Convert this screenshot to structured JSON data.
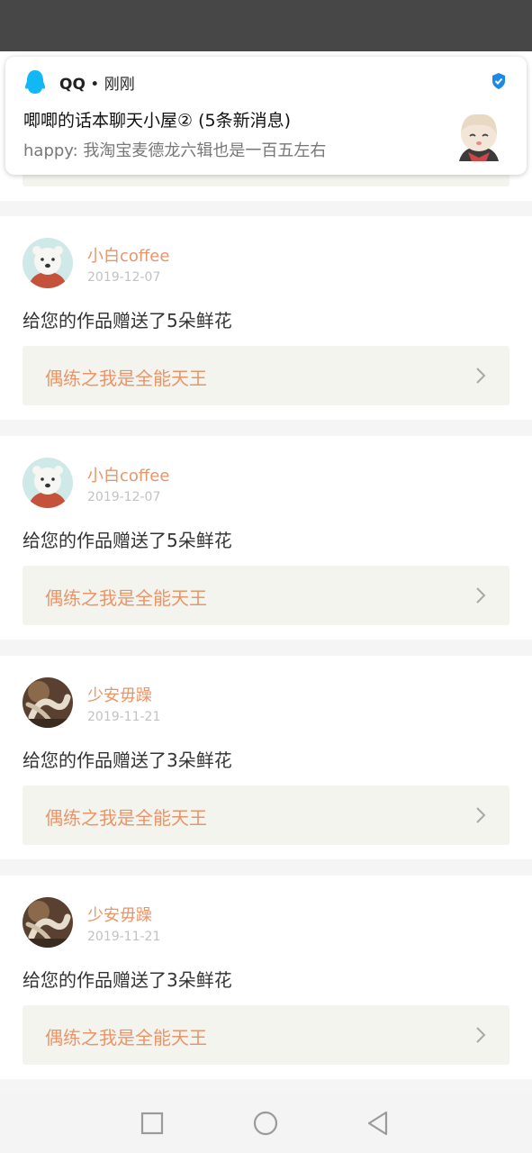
{
  "notification": {
    "app_name": "QQ",
    "separator": " • ",
    "time": "刚刚",
    "title": "唧唧的话本聊天小屋② (5条新消息)",
    "body": "happy: 我淘宝麦德龙六辑也是一百五左右",
    "app_icon": "qq-penguin-icon",
    "badge_icon": "verified-shield-icon",
    "accent_color": "#1e88e5"
  },
  "colors": {
    "username": "#e8956a",
    "date": "#c2c2c2",
    "link_bg": "#f4f4ee",
    "status_bar": "#474747"
  },
  "cards": [
    {
      "username": "小白coffee",
      "date": "2019-12-07",
      "message": "给您的作品赠送了5朵鲜花",
      "work_title": "偶练之我是全能天王"
    },
    {
      "username": "小白coffee",
      "date": "2019-12-07",
      "message": "给您的作品赠送了5朵鲜花",
      "work_title": "偶练之我是全能天王"
    },
    {
      "username": "少安毋躁",
      "date": "2019-11-21",
      "message": "给您的作品赠送了3朵鲜花",
      "work_title": "偶练之我是全能天王"
    },
    {
      "username": "少安毋躁",
      "date": "2019-11-21",
      "message": "给您的作品赠送了3朵鲜花",
      "work_title": "偶练之我是全能天王"
    }
  ],
  "nav": {
    "recent_icon": "square-recents-icon",
    "home_icon": "circle-home-icon",
    "back_icon": "triangle-back-icon"
  }
}
